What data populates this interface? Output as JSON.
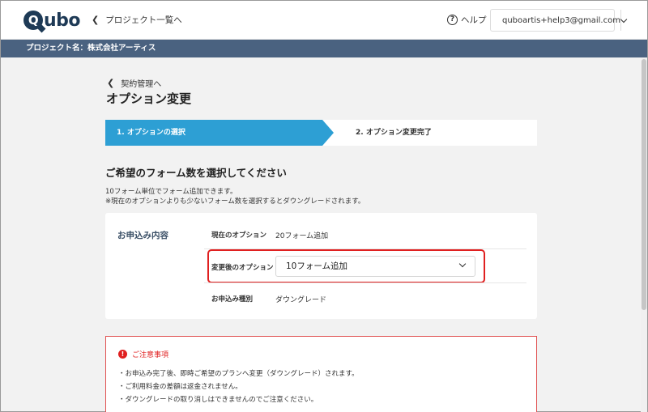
{
  "header": {
    "logo": "Qubo",
    "back_projects": "プロジェクト一覧へ",
    "help": "ヘルプ",
    "account_email": "quboartis+help3@gmail.com"
  },
  "project_bar": {
    "label": "プロジェクト名：株式会社アーティス"
  },
  "main": {
    "back_contract": "契約管理へ",
    "title": "オプション変更",
    "steps": [
      {
        "label": "1. オプションの選択",
        "active": true
      },
      {
        "label": "2. オプション変更完了",
        "active": false
      }
    ],
    "section_title": "ご希望のフォーム数を選択してください",
    "desc1": "10フォーム単位でフォーム追加できます。",
    "desc2": "※現在のオプションよりも少ないフォーム数を選択するとダウングレードされます。",
    "card": {
      "label": "お申込み内容",
      "current_label": "現在のオプション",
      "current_value": "20フォーム追加",
      "new_label": "変更後のオプション",
      "new_value": "10フォーム追加",
      "type_label": "お申込み種別",
      "type_value": "ダウングレード"
    },
    "notice": {
      "title": "ご注意事項",
      "items": [
        "・お申込み完了後、即時ご希望のプランへ変更（ダウングレード）されます。",
        "・ご利用料金の差額は返金されません。",
        "・ダウングレードの取り消しはできませんのでご注意ください。"
      ]
    }
  },
  "colors": {
    "accent": "#2d9fd4",
    "project_bar": "#4a6280",
    "warning": "#e02020",
    "logo": "#1e3a56"
  }
}
